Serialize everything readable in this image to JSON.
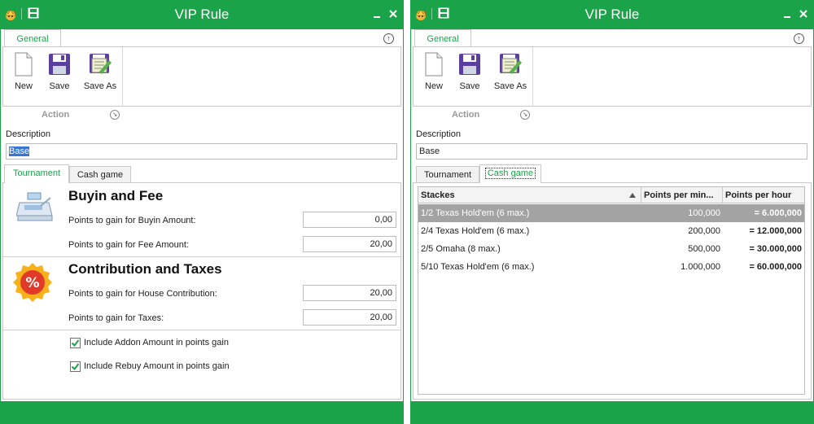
{
  "windows": [
    {
      "id": "left",
      "title": "VIP Rule",
      "ribbon": {
        "tab": "General",
        "buttons": [
          {
            "label": "New"
          },
          {
            "label": "Save"
          },
          {
            "label": "Save As"
          }
        ],
        "group_label": "Action"
      },
      "description": {
        "label": "Description",
        "value": "Base"
      },
      "tabs": [
        "Tournament",
        "Cash game"
      ],
      "active_tab": "Tournament",
      "tournament": {
        "buyin_section": {
          "title": "Buyin and Fee",
          "fields": [
            {
              "label": "Points to gain for Buyin Amount:",
              "value": "0,00"
            },
            {
              "label": "Points to gain for Fee Amount:",
              "value": "20,00"
            }
          ]
        },
        "contribution_section": {
          "title": "Contribution and Taxes",
          "fields": [
            {
              "label": "Points to gain for House Contribution:",
              "value": "20,00"
            },
            {
              "label": "Points to gain for Taxes:",
              "value": "20,00"
            }
          ]
        },
        "checkboxes": [
          {
            "label": "Include Addon Amount in points gain",
            "checked": true
          },
          {
            "label": "Include Rebuy Amount in points gain",
            "checked": true
          }
        ]
      }
    },
    {
      "id": "right",
      "title": "VIP Rule",
      "ribbon": {
        "tab": "General",
        "buttons": [
          {
            "label": "New"
          },
          {
            "label": "Save"
          },
          {
            "label": "Save As"
          }
        ],
        "group_label": "Action"
      },
      "description": {
        "label": "Description",
        "value": "Base"
      },
      "tabs": [
        "Tournament",
        "Cash game"
      ],
      "active_tab": "Cash game",
      "cash_grid": {
        "columns": [
          "Stackes",
          "Points per min...",
          "Points per hour"
        ],
        "rows": [
          {
            "stake": "1/2 Texas Hold'em (6 max.)",
            "per_min": "100,000",
            "per_hour": "= 6.000,000",
            "selected": true
          },
          {
            "stake": "2/4 Texas Hold'em (6 max.)",
            "per_min": "200,000",
            "per_hour": "= 12.000,000",
            "selected": false
          },
          {
            "stake": "2/5 Omaha (8 max.)",
            "per_min": "500,000",
            "per_hour": "= 30.000,000",
            "selected": false
          },
          {
            "stake": "5/10 Texas Hold'em (6 max.)",
            "per_min": "1.000,000",
            "per_hour": "= 60.000,000",
            "selected": false
          }
        ]
      }
    }
  ],
  "colors": {
    "accent": "#1ba34a",
    "selection": "#3875d7",
    "row_selected": "#a3a3a3"
  },
  "icons": [
    "app-crown-icon",
    "save-icon",
    "minimize-icon",
    "close-icon",
    "new-document-icon",
    "save-as-icon",
    "collapse-ribbon-icon",
    "dialog-launcher-icon",
    "cash-register-icon",
    "percent-badge-icon",
    "checkbox-check-icon",
    "sort-ascending-icon"
  ]
}
